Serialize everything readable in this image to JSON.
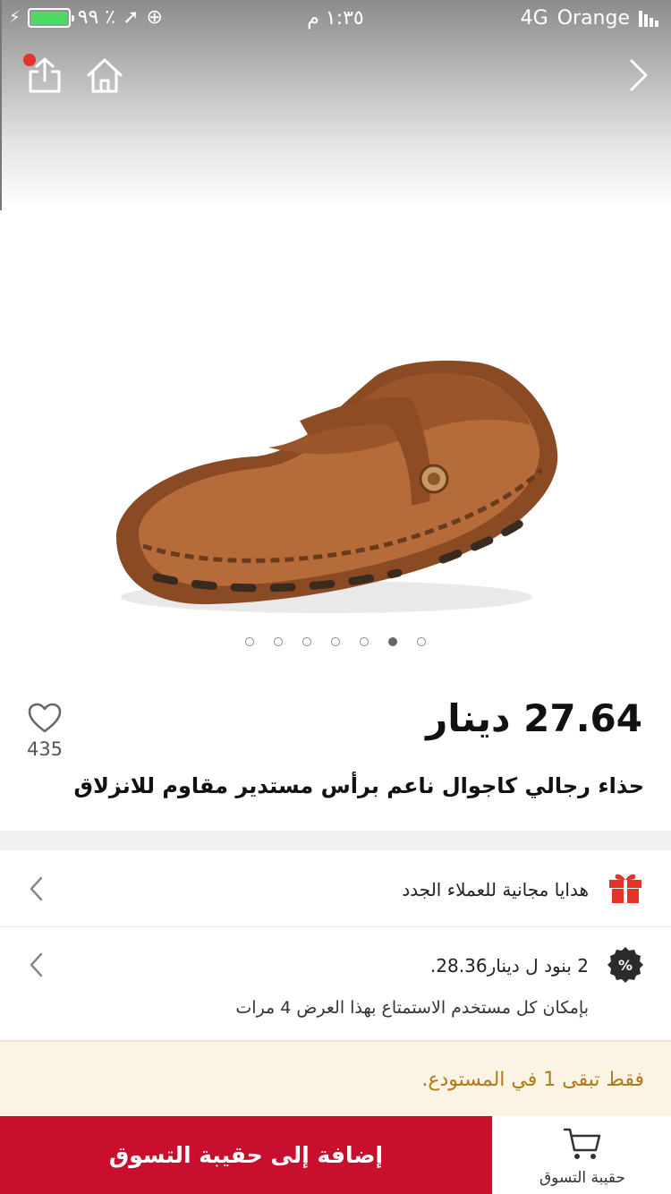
{
  "status_bar": {
    "carrier": "Orange",
    "network": "4G",
    "time": "١:٣٥ م",
    "battery": "٪ ٩٩"
  },
  "product": {
    "price": "27.64 دينار",
    "title": "حذاء رجالي كاجوال ناعم برأس مستدير مقاوم للانزلاق",
    "wishlist_count": "435",
    "image_count": 7,
    "active_image_index": 5
  },
  "offers": {
    "gift_text": "هدايا مجانية للعملاء الجدد",
    "discount_text": "2 بنود ل دينار28.36.",
    "discount_subtext": "بإمكان كل مستخدم الاستمتاع بهذا العرض 4 مرات"
  },
  "stock_notice": "فقط تبقى 1 في المستودع.",
  "bottom_bar": {
    "add_to_bag_label": "إضافة إلى حقيبة التسوق",
    "cart_label": "حقيبة التسوق"
  },
  "icons": {
    "share": "share-icon",
    "home": "home-icon",
    "next": "chevron-right-icon",
    "wishlist": "heart-icon",
    "gift": "gift-icon",
    "discount": "percent-badge-icon",
    "cart": "cart-icon",
    "chevron": "chevron-left-icon"
  },
  "colors": {
    "primary": "#c8102e",
    "gift": "#e5332a",
    "stock_text": "#b07a1a",
    "stock_bg": "#fbf4e5"
  }
}
